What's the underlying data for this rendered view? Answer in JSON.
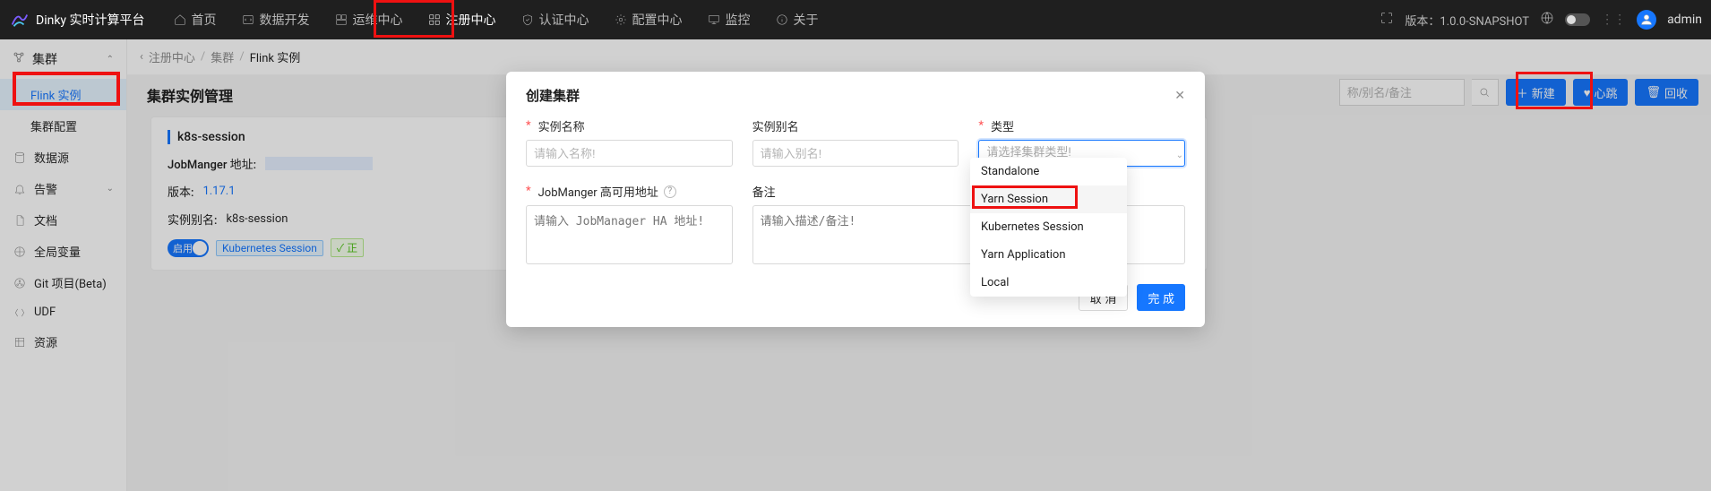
{
  "brand": "Dinky 实时计算平台",
  "nav": {
    "items": [
      {
        "label": "首页",
        "icon": "home-icon"
      },
      {
        "label": "数据开发",
        "icon": "code-icon"
      },
      {
        "label": "运维中心",
        "icon": "dashboard-icon"
      },
      {
        "label": "注册中心",
        "icon": "grid-icon",
        "active": true
      },
      {
        "label": "认证中心",
        "icon": "shield-icon"
      },
      {
        "label": "配置中心",
        "icon": "gear-icon"
      },
      {
        "label": "监控",
        "icon": "monitor-icon"
      },
      {
        "label": "关于",
        "icon": "info-icon"
      }
    ]
  },
  "topright": {
    "version_prefix": "版本：",
    "version": "1.0.0-SNAPSHOT",
    "user": "admin"
  },
  "sidebar": {
    "group": {
      "label": "集群",
      "icon": "cluster-icon"
    },
    "sub": [
      {
        "label": "Flink 实例",
        "active": true
      },
      {
        "label": "集群配置"
      }
    ],
    "rest": [
      {
        "label": "数据源",
        "icon": "db-icon"
      },
      {
        "label": "告警",
        "icon": "bell-icon",
        "caret": true
      },
      {
        "label": "文档",
        "icon": "doc-icon"
      },
      {
        "label": "全局变量",
        "icon": "var-icon"
      },
      {
        "label": "Git 项目(Beta)",
        "icon": "git-icon"
      },
      {
        "label": "UDF",
        "icon": "fn-icon"
      },
      {
        "label": "资源",
        "icon": "res-icon"
      }
    ]
  },
  "breadcrumb": {
    "a": "注册中心",
    "b": "集群",
    "c": "Flink 实例"
  },
  "page": {
    "title": "集群实例管理"
  },
  "toolbar": {
    "search_placeholder": "称/别名/备注",
    "new_label": "新建",
    "heartbeat_label": "心跳",
    "recycle_label": "回收"
  },
  "card": {
    "name": "k8s-session",
    "jobmanager_key": "JobManger 地址:",
    "version_key": "版本:",
    "version_val": "1.17.1",
    "alias_key": "实例别名:",
    "alias_val": "k8s-session",
    "enable_label": "启用",
    "type_tag": "Kubernetes Session",
    "status_tag": "正"
  },
  "modal": {
    "title": "创建集群",
    "fields": {
      "name": {
        "label": "实例名称",
        "placeholder": "请输入名称!"
      },
      "alias": {
        "label": "实例别名",
        "placeholder": "请输入别名!"
      },
      "type": {
        "label": "类型",
        "placeholder": "请选择集群类型!"
      },
      "jmha": {
        "label": "JobManger 高可用地址",
        "placeholder": "请输入 JobManager HA 地址!"
      },
      "remark": {
        "label": "备注",
        "placeholder": "请输入描述/备注!"
      }
    },
    "dropdown": [
      "Standalone",
      "Yarn Session",
      "Kubernetes Session",
      "Yarn Application",
      "Local"
    ],
    "cancel": "取 消",
    "ok": "完 成"
  }
}
